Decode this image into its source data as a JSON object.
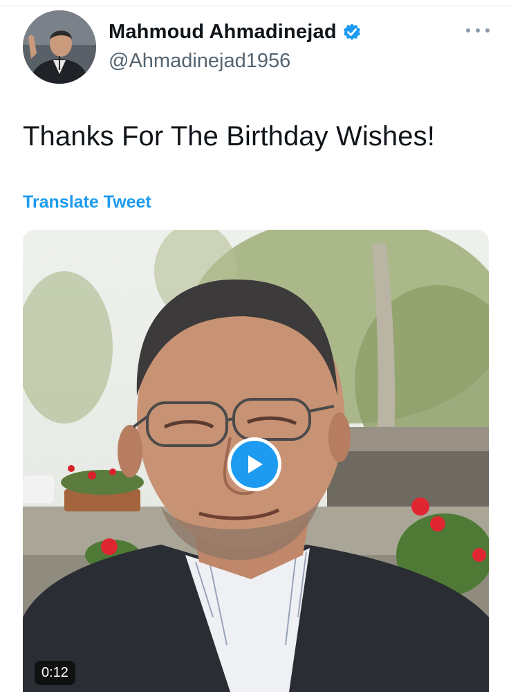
{
  "tweet": {
    "author_name": "Mahmoud Ahmadinejad",
    "handle": "@Ahmadinejad1956",
    "text": "Thanks For The Birthday Wishes!",
    "translate_label": "Translate Tweet",
    "verified": true
  },
  "media": {
    "type": "video",
    "duration": "0:12"
  },
  "icons": {
    "verified": "verified-badge-icon",
    "more": "more-options-icon",
    "play": "play-icon"
  },
  "colors": {
    "accent": "#1d9bf0",
    "text_primary": "#0f1419",
    "text_secondary": "#536471"
  }
}
